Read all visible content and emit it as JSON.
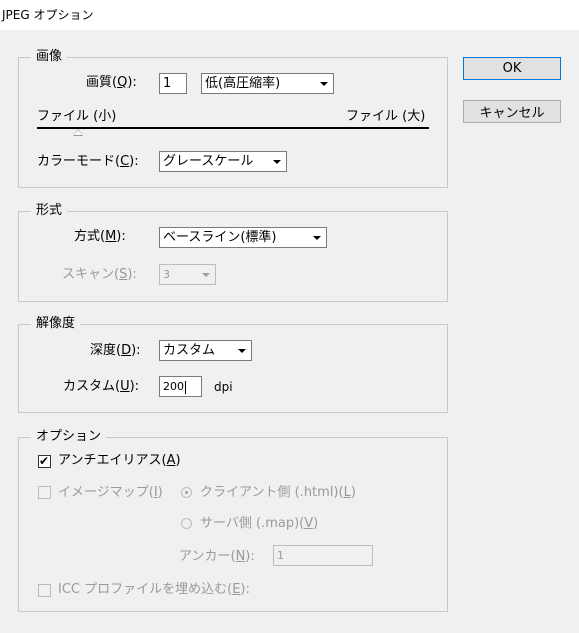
{
  "window": {
    "title": "JPEG オプション"
  },
  "buttons": {
    "ok": "OK",
    "cancel": "キャンセル"
  },
  "image": {
    "group_title": "画像",
    "quality_label_pre": "画質(",
    "quality_label_key": "Q",
    "quality_label_post": "):",
    "quality_value": "1",
    "quality_preset": "低(高圧縮率)",
    "slider_min_label": "ファイル (小)",
    "slider_max_label": "ファイル (大)",
    "color_mode_label_pre": "カラーモード(",
    "color_mode_label_key": "C",
    "color_mode_label_post": "):",
    "color_mode_value": "グレースケール"
  },
  "format": {
    "group_title": "形式",
    "method_label_pre": "方式(",
    "method_label_key": "M",
    "method_label_post": "):",
    "method_value": "ベースライン(標準)",
    "scan_label_pre": "スキャン(",
    "scan_label_key": "S",
    "scan_label_post": "):",
    "scan_value": "3"
  },
  "resolution": {
    "group_title": "解像度",
    "depth_label_pre": "深度(",
    "depth_label_key": "D",
    "depth_label_post": "):",
    "depth_value": "カスタム",
    "custom_label_pre": "カスタム(",
    "custom_label_key": "U",
    "custom_label_post": "):",
    "custom_value": "200",
    "unit": "dpi"
  },
  "options": {
    "group_title": "オプション",
    "antialias_pre": "アンチエイリアス(",
    "antialias_key": "A",
    "antialias_post": ")",
    "antialias_checked": true,
    "checkmark": "✔",
    "imagemap_pre": "イメージマップ(",
    "imagemap_key": "I",
    "imagemap_post": ")",
    "client_pre": "クライアント側 (.html)(",
    "client_key": "L",
    "client_post": ")",
    "server_pre": "サーバ側 (.map)(",
    "server_key": "V",
    "server_post": ")",
    "anchor_pre": "アンカー(",
    "anchor_key": "N",
    "anchor_post": "):",
    "anchor_value": "1",
    "icc_pre": "ICC プロファイルを埋め込む(",
    "icc_key": "E",
    "icc_post": "):"
  }
}
